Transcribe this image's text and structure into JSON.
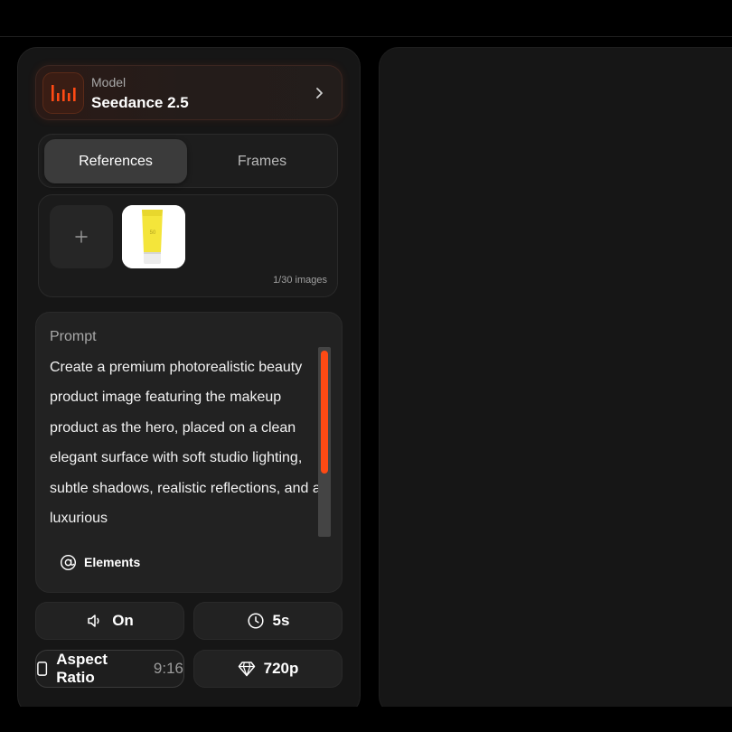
{
  "model": {
    "label": "Model",
    "name": "Seedance 2.5",
    "logo_icon": "bars-logo-icon",
    "accent": "#ff4a14"
  },
  "tabs": [
    {
      "label": "References",
      "active": true
    },
    {
      "label": "Frames",
      "active": false
    }
  ],
  "references": {
    "add_icon": "plus-icon",
    "count": "1/30 images",
    "thumbnail": "sunscreen-tube-thumbnail"
  },
  "prompt": {
    "label": "Prompt",
    "text": "Create a premium photorealistic beauty product image featuring the makeup product as the hero, placed on a clean elegant surface with soft studio lighting, subtle shadows, realistic reflections, and a luxurious",
    "elements_label": "Elements"
  },
  "controls": {
    "audio": {
      "icon": "speaker-icon",
      "value": "On"
    },
    "duration": {
      "icon": "clock-icon",
      "value": "5s"
    },
    "aspect": {
      "icon": "phone-portrait-icon",
      "label": "Aspect Ratio",
      "value": "9:16"
    },
    "resolution": {
      "icon": "diamond-icon",
      "value": "720p"
    }
  }
}
